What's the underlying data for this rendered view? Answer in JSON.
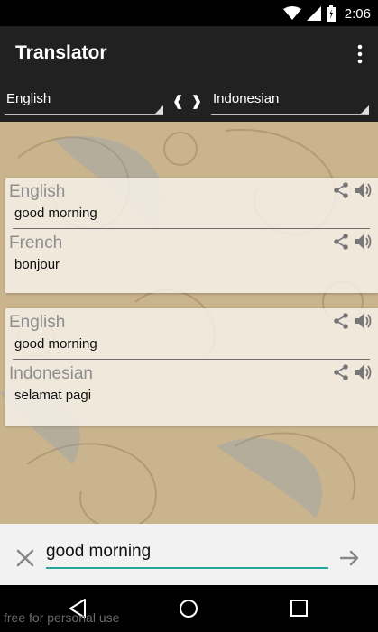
{
  "status_bar": {
    "time": "2:06"
  },
  "app_bar": {
    "title": "Translator"
  },
  "languages": {
    "from": "English",
    "to": "Indonesian",
    "swap": "❰❱"
  },
  "translations": [
    {
      "source": {
        "language": "English",
        "text": "good morning"
      },
      "target": {
        "language": "French",
        "text": "bonjour"
      }
    },
    {
      "source": {
        "language": "English",
        "text": "good morning"
      },
      "target": {
        "language": "Indonesian",
        "text": "selamat pagi"
      }
    }
  ],
  "input": {
    "value": "good morning"
  },
  "watermark": "free for personal use",
  "colors": {
    "app_bar": "#212121",
    "accent": "#26a69a",
    "content_bg": "#c9b48d"
  }
}
